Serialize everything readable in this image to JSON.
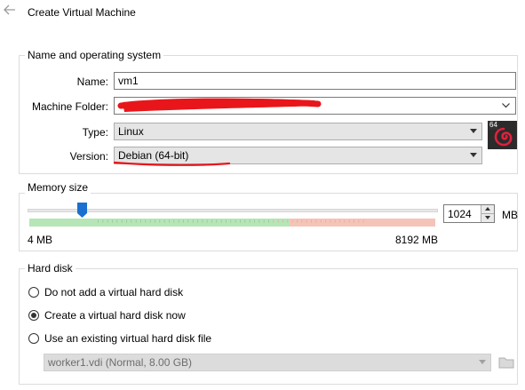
{
  "window": {
    "title": "Create Virtual Machine"
  },
  "name_os": {
    "legend": "Name and operating system",
    "name_label": "Name:",
    "name_value": "vm1",
    "folder_label": "Machine Folder:",
    "type_label": "Type:",
    "type_value": "Linux",
    "version_label": "Version:",
    "version_value": "Debian (64-bit)",
    "os_badge": "64"
  },
  "memory": {
    "legend": "Memory size",
    "min_label": "4 MB",
    "max_label": "8192 MB",
    "value": "1024",
    "unit": "MB"
  },
  "hard_disk": {
    "legend": "Hard disk",
    "options": [
      {
        "label": "Do not add a virtual hard disk",
        "checked": false
      },
      {
        "label": "Create a virtual hard disk now",
        "checked": true
      },
      {
        "label": "Use an existing virtual hard disk file",
        "checked": false
      }
    ],
    "existing_file": "worker1.vdi (Normal, 8.00 GB)"
  },
  "colors": {
    "annotation_red": "#e8161b",
    "slider_thumb": "#1a6fd0"
  }
}
